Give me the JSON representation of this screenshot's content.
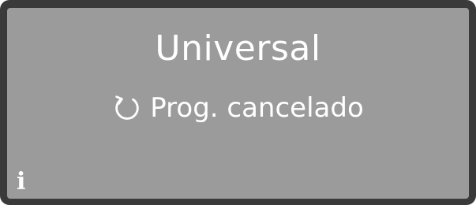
{
  "display": {
    "program_name": "Universal",
    "status_text": "Prog. cancelado",
    "status_icon": "cancel-icon",
    "info_icon": "info-icon",
    "info_glyph": "i"
  },
  "colors": {
    "screen": "#9b9b9b",
    "bezel": "#3a3a3a",
    "text": "#ffffff"
  }
}
